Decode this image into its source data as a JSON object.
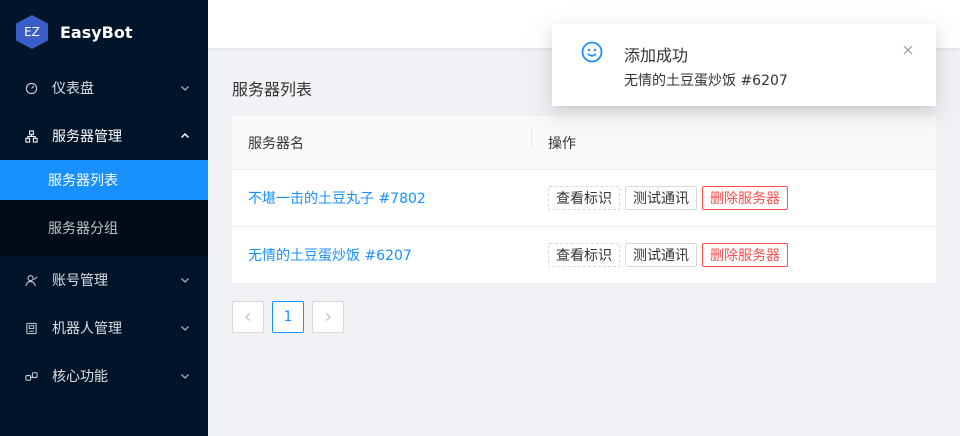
{
  "app": {
    "logo_mark": "EZ",
    "name": "EasyBot"
  },
  "sidebar": {
    "items": [
      {
        "label": "仪表盘",
        "icon": "dashboard-icon"
      },
      {
        "label": "服务器管理",
        "icon": "cluster-icon"
      },
      {
        "label": "账号管理",
        "icon": "user-icon"
      },
      {
        "label": "机器人管理",
        "icon": "robot-icon"
      },
      {
        "label": "核心功能",
        "icon": "api-icon"
      }
    ],
    "server_submenu": [
      {
        "label": "服务器列表",
        "active": true
      },
      {
        "label": "服务器分组",
        "active": false
      }
    ]
  },
  "page": {
    "title": "服务器列表"
  },
  "table": {
    "columns": [
      "服务器名",
      "操作"
    ],
    "rows": [
      {
        "name": "不堪一击的土豆丸子 #7802",
        "actions": [
          "查看标识",
          "测试通讯",
          "删除服务器"
        ]
      },
      {
        "name": "无情的土豆蛋炒饭 #6207",
        "actions": [
          "查看标识",
          "测试通讯",
          "删除服务器"
        ]
      }
    ]
  },
  "pagination": {
    "current": "1"
  },
  "notification": {
    "title": "添加成功",
    "description": "无情的土豆蛋炒饭 #6207",
    "icon": "smile-icon"
  },
  "colors": {
    "sidebar_bg": "#001529",
    "accent": "#1890ff",
    "danger": "#ff4d4f"
  }
}
